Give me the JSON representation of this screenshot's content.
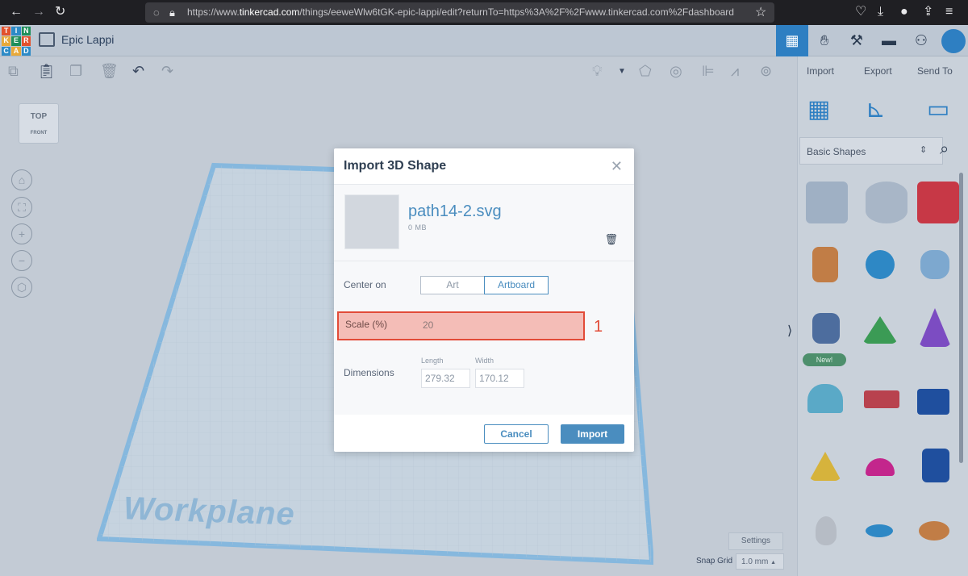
{
  "browser": {
    "url_prefix": "https://www.",
    "url_domain": "tinkercad.com",
    "url_rest": "/things/eeweWlw6tGK-epic-lappi/edit?returnTo=https%3A%2F%2Fwww.tinkercad.com%2Fdashboard"
  },
  "app": {
    "logo_letters": [
      "T",
      "I",
      "N",
      "K",
      "E",
      "R",
      "C",
      "A",
      "D"
    ],
    "document_title": "Epic Lappi"
  },
  "panel": {
    "import_label": "Import",
    "export_label": "Export",
    "sendto_label": "Send To",
    "shape_category": "Basic Shapes",
    "new_badge": "New!"
  },
  "workspace": {
    "viewcube_label": "TOP",
    "viewcube_front": "FRONT",
    "workplane_label": "Workplane",
    "settings_label": "Settings",
    "snap_grid_label": "Snap Grid",
    "snap_grid_value": "1.0 mm"
  },
  "modal": {
    "title": "Import 3D Shape",
    "file_name": "path14-2.svg",
    "file_size": "0 MB",
    "center_on_label": "Center on",
    "center_art": "Art",
    "center_artboard": "Artboard",
    "scale_label": "Scale (%)",
    "scale_value": "20",
    "step_marker": "1",
    "dimensions_label": "Dimensions",
    "length_label": "Length",
    "width_label": "Width",
    "length_value": "279.32",
    "width_value": "170.12",
    "cancel_label": "Cancel",
    "import_label": "Import"
  }
}
